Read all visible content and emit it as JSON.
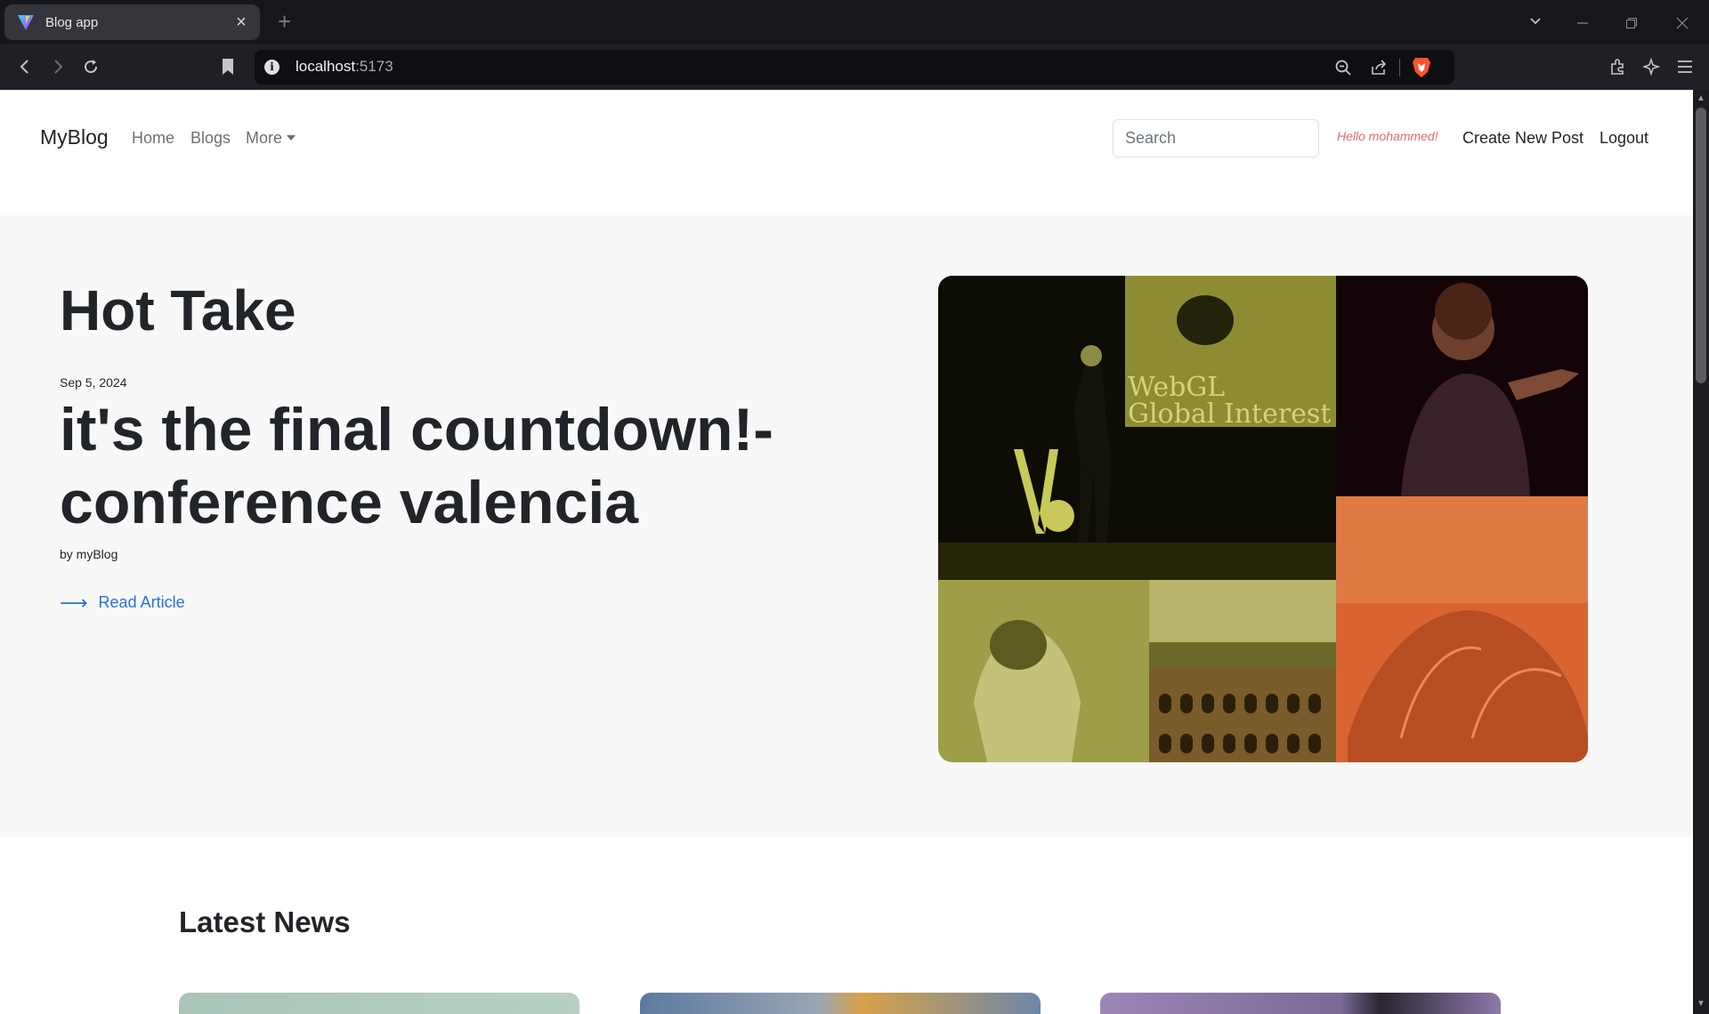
{
  "browser": {
    "tab_title": "Blog app",
    "tab_close": "×",
    "new_tab": "+",
    "url_host": "localhost",
    "url_port": ":5173",
    "icons": [
      "back-icon",
      "forward-icon",
      "reload-icon",
      "bookmark-icon",
      "info-icon",
      "zoom-icon",
      "share-icon",
      "brave-shield-icon",
      "extensions-icon",
      "leo-ai-icon",
      "menu-icon",
      "tab-search-icon",
      "minimize-icon",
      "restore-icon",
      "close-icon"
    ]
  },
  "navbar": {
    "brand": "MyBlog",
    "links": [
      "Home",
      "Blogs",
      "More"
    ],
    "search_placeholder": "Search",
    "greeting": "Hello mohammed!",
    "create_post": "Create New Post",
    "logout": "Logout"
  },
  "hero": {
    "kicker": "Hot Take",
    "date": "Sep 5, 2024",
    "title": "it's the final countdown!- conference valencia",
    "byline": "by myBlog",
    "read_more": "Read Article",
    "arrow": "⟶",
    "image_text": [
      "WebGL",
      "Global Interest"
    ]
  },
  "latest": {
    "heading": "Latest News"
  },
  "colors": {
    "accent_link": "#2672d8",
    "greeting": "#e36a6a",
    "hero_bg": "#f8f8f8",
    "collage_yellow": "#a5a63a",
    "collage_orange": "#d8632f"
  }
}
